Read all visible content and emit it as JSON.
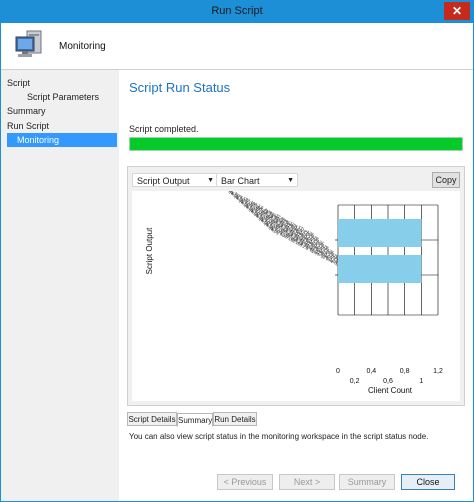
{
  "window": {
    "title": "Run Script",
    "close_glyph": "✕"
  },
  "header": {
    "title": "Monitoring",
    "icon": "computer-monitor-icon"
  },
  "sidebar": {
    "items": [
      {
        "label": "Script",
        "level": 0,
        "active": false
      },
      {
        "label": "Script Parameters",
        "level": 1,
        "active": false
      },
      {
        "label": "Summary",
        "level": 0,
        "active": false
      },
      {
        "label": "Run Script",
        "level": 0,
        "active": false
      },
      {
        "label": "Monitoring",
        "level": 0,
        "active": true
      }
    ]
  },
  "main": {
    "title": "Script Run Status",
    "status": "Script completed.",
    "progress": 1.0,
    "progress_color": "#06c92c",
    "accent_color": "#1a73c8",
    "toolbar": {
      "output_select": "Script Output",
      "view_select": "Bar Chart",
      "copy_label": "Copy"
    },
    "tabs": [
      {
        "label": "Script Details",
        "active": false
      },
      {
        "label": "Summary",
        "active": true
      },
      {
        "label": "Run Details",
        "active": false
      }
    ],
    "info": "You can also view script status in the monitoring workspace in the script status node."
  },
  "buttons": {
    "previous": "< Previous",
    "next": "Next >",
    "summary": "Summary",
    "close": "Close"
  },
  "chart_data": {
    "type": "bar",
    "orientation": "horizontal",
    "categories": [
      "Reply from 192.168.2.5: bytes=32 time<1ms TTL=128",
      "Reply from 192.168.2.5: bytes=32 time<1ms TTL=128",
      "Reply from 192.168.2.5: bytes=32 time<1ms TTL=128",
      "Reply from 192.168.2.5: bytes=32 time<1ms TTL=128",
      "Reply from 192.168.2.5: bytes=32 time<1ms TTL=128",
      "Reply from 192.168.2.5: bytes=32 time<1ms TTL=128",
      "Reply from 192.168.2.5: bytes=32 time<1ms TTL=128",
      "Reply from 192.168.2.5: bytes=32 time<1ms TTL=128",
      "Reply from 192.168.2.5: bytes=32 time<1ms TTL=128",
      "Reply from 192.168.2.5: bytes=32 time<1ms TTL=128"
    ],
    "bars": [
      {
        "value": 1
      },
      {
        "value": 1
      }
    ],
    "xlabel": "Client Count",
    "ylabel": "Script Output",
    "xlim": [
      0,
      1.2
    ],
    "xticks_top": [
      "0",
      "0,4",
      "0,8",
      "1,2"
    ],
    "xticks_bottom": [
      "0,2",
      "0,6",
      "1"
    ],
    "bar_color": "#87ceeb",
    "grid": true
  }
}
